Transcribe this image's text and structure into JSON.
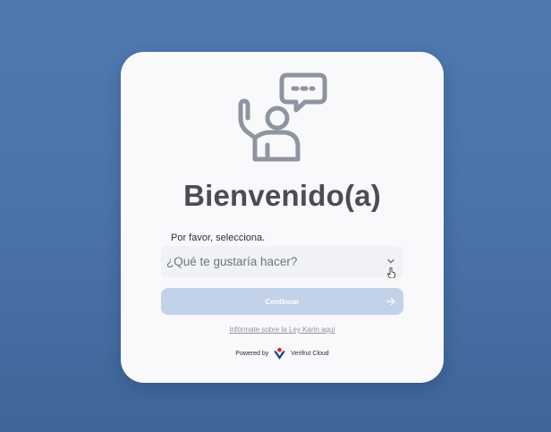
{
  "card": {
    "title": "Bienvenido(a)",
    "prompt": "Por favor, selecciona.",
    "select": {
      "placeholder": "¿Qué te gustaría hacer?",
      "icon": "chevron-down-icon"
    },
    "continue_button": {
      "label": "Continuar",
      "icon": "arrow-right-icon"
    },
    "info_link": "Infórmate sobre la Ley Karin aquí",
    "footer": {
      "powered_by": "Powered by",
      "brand": "Verifrut Cloud"
    }
  },
  "colors": {
    "background": "#4b74aa",
    "card": "#f9f9fb",
    "button": "#c2d2e9",
    "icon": "#8e94a0",
    "title": "#4a4d55"
  }
}
